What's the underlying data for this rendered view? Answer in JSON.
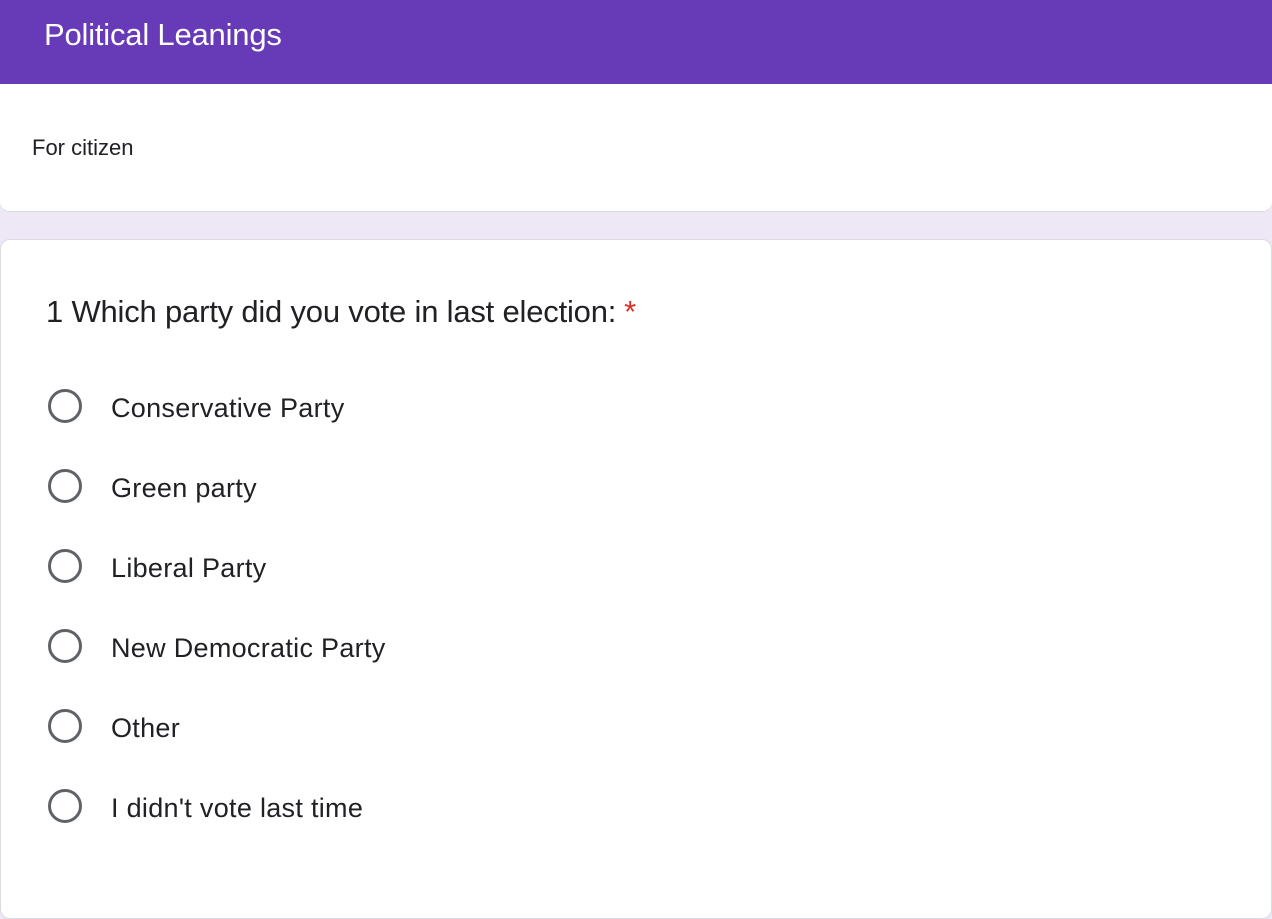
{
  "form": {
    "title": "Political Leanings",
    "description": "For citizen",
    "accent_color": "#673ab7",
    "background_color": "#ede7f6"
  },
  "question": {
    "title": "1 Which party did you vote in last election:",
    "required_marker": "*",
    "required": true,
    "type": "multiple-choice",
    "options": [
      {
        "label": "Conservative Party",
        "selected": false
      },
      {
        "label": "Green party",
        "selected": false
      },
      {
        "label": "Liberal Party",
        "selected": false
      },
      {
        "label": "New Democratic Party",
        "selected": false
      },
      {
        "label": "Other",
        "selected": false
      },
      {
        "label": "I didn't vote last time",
        "selected": false
      }
    ]
  }
}
